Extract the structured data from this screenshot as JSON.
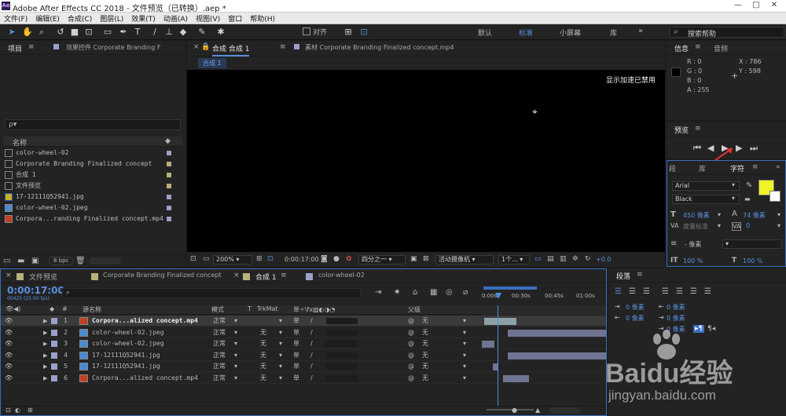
{
  "app": {
    "title": "Adobe After Effects CC 2018 - 文件预览（已转换）.aep *",
    "icon": "Ae"
  },
  "menu": [
    "文件(F)",
    "编辑(E)",
    "合成(C)",
    "图层(L)",
    "效果(T)",
    "动画(A)",
    "视图(V)",
    "窗口",
    "帮助(H)"
  ],
  "toolbar": {
    "align_label": "对齐",
    "workspaces": [
      "默认",
      "标准",
      "小屏幕",
      "库"
    ],
    "active_workspace": "标准",
    "search_placeholder": "搜索帮助"
  },
  "project": {
    "tab": "项目",
    "effects_tab": "效果控件 Corporate Branding F",
    "search_placeholder": "ρ▾",
    "col_name": "名称",
    "items": [
      {
        "name": "color-wheel-02",
        "type": "comp",
        "color": "#9aa0c8"
      },
      {
        "name": "Corporate Branding  Finalized concept",
        "type": "comp",
        "color": "#b8b07a"
      },
      {
        "name": "合成 1",
        "type": "comp",
        "color": "#b8b07a"
      },
      {
        "name": "文件预览",
        "type": "comp",
        "color": "#b8b07a"
      },
      {
        "name": "17-12111Q52941.jpg",
        "type": "image",
        "color": "#9aa0c8"
      },
      {
        "name": "color-wheel-02.jpeg",
        "type": "image",
        "color": "#9aa0c8"
      },
      {
        "name": "Corpora...randing  Finalized concept.mp4",
        "type": "video",
        "color": "#9aa0c8"
      }
    ],
    "bpc": "8 bpc"
  },
  "composition": {
    "tab": "合成 合成 1",
    "footage_tab": "素材 Corporate Branding  Finalized concept.mp4",
    "sub_tab": "合成 1",
    "notice": "显示加速已禁用",
    "zoom": "200%",
    "time": "0:00:17:00",
    "resolution": "四分之一",
    "camera": "活动摄像机",
    "views": "1个...",
    "exposure": "+0.0"
  },
  "info": {
    "tab": "信息",
    "audio_tab": "音频",
    "R": "R : 0",
    "G": "G : 0",
    "B": "B : 0",
    "A": "A : 255",
    "X": "X : 786",
    "Y": "Y : 598"
  },
  "preview": {
    "tab": "预览"
  },
  "character": {
    "tabs": [
      "段",
      "库",
      "字符"
    ],
    "font": "Arial",
    "style": "Black",
    "size": "450 像素",
    "leading": "74 像素",
    "kerning": "度量标准",
    "tracking": "0",
    "stroke": "- 像素",
    "vscale": "100 %",
    "hscale": "100 %"
  },
  "paragraph": {
    "tab": "段落",
    "values": [
      "0 像素",
      "0 像素",
      "0 像素",
      "0 像素",
      "0 像素"
    ]
  },
  "timeline": {
    "tabs": [
      "文件预览",
      "Corporate Branding  Finalized concept",
      "合成 1",
      "color-wheel-02"
    ],
    "time": "0:00:17:00",
    "frames": "00425 (25.00 fps)",
    "headers": {
      "num": "#",
      "src": "源名称",
      "mode": "模式",
      "t": "T",
      "trkmat": "TrkMat",
      "parent": "父级"
    },
    "ruler": [
      "0:00s",
      "00:30s",
      "00:45s",
      "01:00s"
    ],
    "layers": [
      {
        "num": "1",
        "name": "Corpora...alized concept.mp4",
        "mode": "正常",
        "trkmat": "",
        "parent": "无",
        "color": "#9aa0c8",
        "type": "video",
        "selected": true,
        "bar": [
          0.02,
          0.28
        ]
      },
      {
        "num": "2",
        "name": "color-wheel-02.jpeg",
        "mode": "正常",
        "trkmat": "无",
        "parent": "无",
        "color": "#9aa0c8",
        "type": "image",
        "bar": [
          0.21,
          1.0
        ]
      },
      {
        "num": "3",
        "name": "color-wheel-02.jpeg",
        "mode": "正常",
        "trkmat": "无",
        "parent": "无",
        "color": "#9aa0c8",
        "type": "image",
        "bar": [
          0.0,
          0.1
        ]
      },
      {
        "num": "4",
        "name": "17-12111Q52941.jpg",
        "mode": "正常",
        "trkmat": "无",
        "parent": "无",
        "color": "#9aa0c8",
        "type": "image",
        "bar": [
          0.21,
          1.0
        ]
      },
      {
        "num": "5",
        "name": "17-12111Q52941.jpg",
        "mode": "正常",
        "trkmat": "无",
        "parent": "无",
        "color": "#9aa0c8",
        "type": "image",
        "bar": [
          0.09,
          0.13
        ]
      },
      {
        "num": "6",
        "name": "Corpora...alized concept.mp4",
        "mode": "正常",
        "trkmat": "无",
        "parent": "无",
        "color": "#9aa0c8",
        "type": "video",
        "bar": [
          0.17,
          0.38
        ]
      }
    ]
  },
  "watermark": {
    "text": "Baidu经验",
    "url": "jingyan.baidu.com"
  }
}
